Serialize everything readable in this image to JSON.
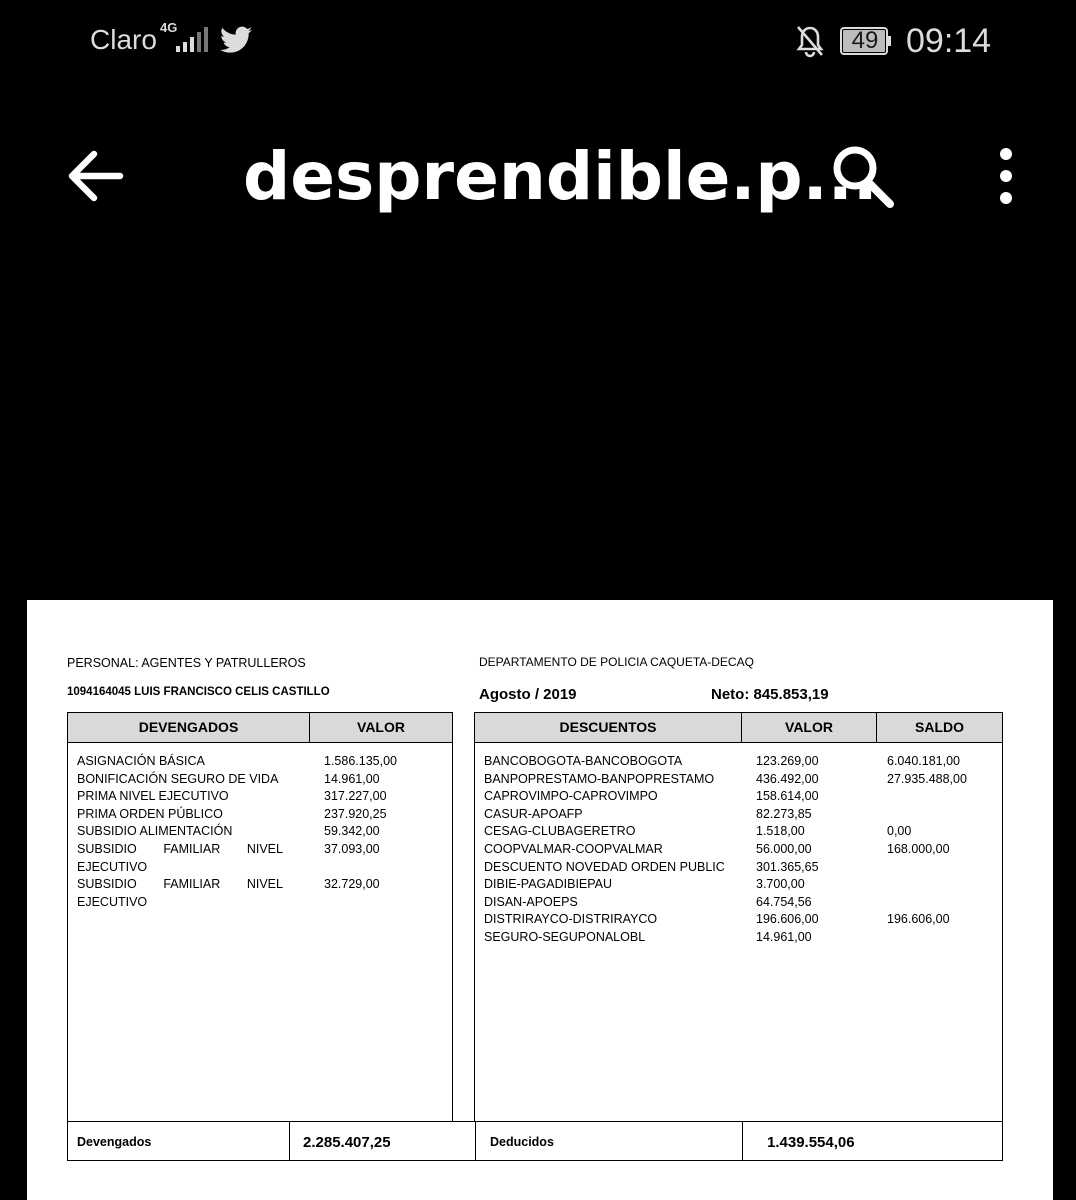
{
  "status_bar": {
    "carrier": "Claro",
    "network": "4G",
    "battery": "49",
    "time": "09:14"
  },
  "toolbar": {
    "title": "desprendible.p..."
  },
  "document": {
    "personal": "PERSONAL: AGENTES Y PATRULLEROS",
    "departamento": "DEPARTAMENTO DE POLICIA CAQUETA-DECAQ",
    "empleado": "1094164045  LUIS FRANCISCO CELIS CASTILLO",
    "periodo": "Agosto / 2019",
    "neto": "Neto: 845.853,19",
    "devengados_table": {
      "headers": [
        "DEVENGADOS",
        "VALOR"
      ],
      "rows": [
        {
          "concepto": "ASIGNACIÓN BÁSICA",
          "valor": "1.586.135,00"
        },
        {
          "concepto": "BONIFICACIÓN SEGURO DE VIDA",
          "valor": "14.961,00"
        },
        {
          "concepto": "PRIMA NIVEL EJECUTIVO",
          "valor": "317.227,00"
        },
        {
          "concepto": "PRIMA ORDEN PÚBLICO",
          "valor": "237.920,25"
        },
        {
          "concepto": "SUBSIDIO ALIMENTACIÓN",
          "valor": "59.342,00"
        },
        {
          "concepto_words": [
            "SUBSIDIO",
            "FAMILIAR",
            "NIVEL"
          ],
          "concepto_line2": "EJECUTIVO",
          "valor": "37.093,00"
        },
        {
          "concepto_words": [
            "SUBSIDIO",
            "FAMILIAR",
            "NIVEL"
          ],
          "concepto_line2": "EJECUTIVO",
          "valor": "32.729,00"
        }
      ]
    },
    "descuentos_table": {
      "headers": [
        "DESCUENTOS",
        "VALOR",
        "SALDO"
      ],
      "rows": [
        {
          "concepto": "BANCOBOGOTA-BANCOBOGOTA",
          "valor": "123.269,00",
          "saldo": "6.040.181,00"
        },
        {
          "concepto": "BANPOPRESTAMO-BANPOPRESTAMO",
          "valor": "436.492,00",
          "saldo": "27.935.488,00"
        },
        {
          "concepto": "CAPROVIMPO-CAPROVIMPO",
          "valor": "158.614,00",
          "saldo": ""
        },
        {
          "concepto": "CASUR-APOAFP",
          "valor": "82.273,85",
          "saldo": ""
        },
        {
          "concepto": "CESAG-CLUBAGERETRO",
          "valor": "1.518,00",
          "saldo": "0,00"
        },
        {
          "concepto": "COOPVALMAR-COOPVALMAR",
          "valor": "56.000,00",
          "saldo": "168.000,00"
        },
        {
          "concepto": "DESCUENTO NOVEDAD ORDEN PUBLIC",
          "valor": "301.365,65",
          "saldo": ""
        },
        {
          "concepto": "DIBIE-PAGADIBIEPAU",
          "valor": "3.700,00",
          "saldo": ""
        },
        {
          "concepto": "DISAN-APOEPS",
          "valor": "64.754,56",
          "saldo": ""
        },
        {
          "concepto": "DISTRIRAYCO-DISTRIRAYCO",
          "valor": "196.606,00",
          "saldo": "196.606,00"
        },
        {
          "concepto": "SEGURO-SEGUPONALOBL",
          "valor": "14.961,00",
          "saldo": ""
        }
      ]
    },
    "totals": {
      "devengados_label": "Devengados",
      "devengados_value": "2.285.407,25",
      "deducidos_label": "Deducidos",
      "deducidos_value": "1.439.554,06"
    }
  }
}
